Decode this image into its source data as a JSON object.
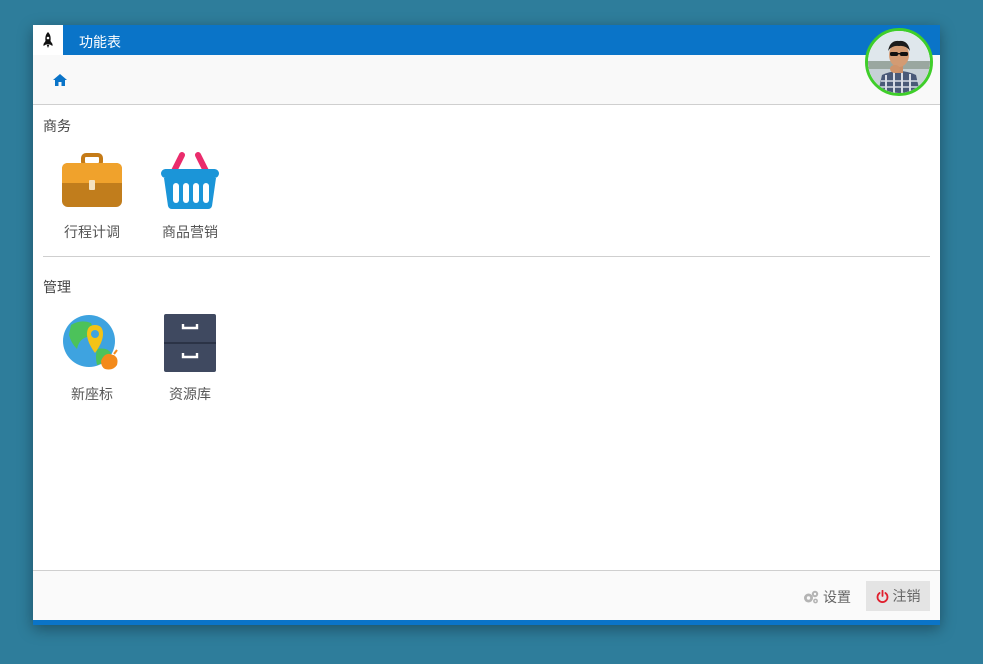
{
  "window": {
    "title": "功能表",
    "accent_color": "#0a74c8",
    "avatar_border_color": "#3fce2a"
  },
  "toolbar": {
    "home_icon": "home-icon"
  },
  "sections": [
    {
      "title": "商务",
      "items": [
        {
          "label": "行程计调",
          "icon": "briefcase-icon"
        },
        {
          "label": "商品营销",
          "icon": "shopping-basket-icon"
        }
      ]
    },
    {
      "title": "管理",
      "items": [
        {
          "label": "新座标",
          "icon": "globe-location-icon"
        },
        {
          "label": "资源库",
          "icon": "filing-cabinet-icon"
        }
      ]
    }
  ],
  "footer": {
    "settings_label": "设置",
    "settings_icon": "gears-icon",
    "logout_label": "注销",
    "logout_icon": "power-icon",
    "logout_icon_color": "#e0202e"
  }
}
